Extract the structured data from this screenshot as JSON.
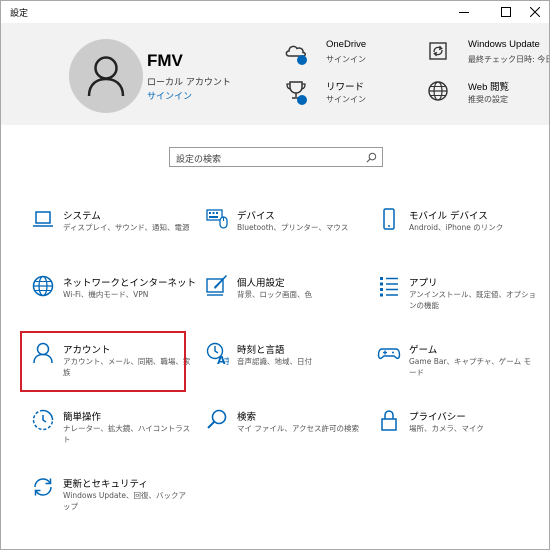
{
  "window": {
    "title": "設定"
  },
  "user": {
    "name": "FMV",
    "type": "ローカル アカウント",
    "signin": "サインイン"
  },
  "header_items": {
    "onedrive": {
      "title": "OneDrive",
      "sub": "サインイン"
    },
    "rewards": {
      "title": "リワード",
      "sub": "サインイン"
    },
    "update": {
      "title": "Windows Update",
      "sub": "最終チェック日時: 今日"
    },
    "web": {
      "title": "Web 閲覧",
      "sub": "推奨の設定"
    }
  },
  "search": {
    "placeholder": "設定の検索"
  },
  "categories": [
    {
      "title": "システム",
      "desc": "ディスプレイ、サウンド、通知、電源"
    },
    {
      "title": "デバイス",
      "desc": "Bluetooth、プリンター、マウス"
    },
    {
      "title": "モバイル デバイス",
      "desc": "Android、iPhone のリンク"
    },
    {
      "title": "ネットワークとインターネット",
      "desc": "Wi-Fi、機内モード、VPN"
    },
    {
      "title": "個人用設定",
      "desc": "背景、ロック画面、色"
    },
    {
      "title": "アプリ",
      "desc": "アンインストール、既定値、オプションの機能"
    },
    {
      "title": "アカウント",
      "desc": "アカウント、メール、同期、職場、家族"
    },
    {
      "title": "時刻と言語",
      "desc": "音声認識、地域、日付"
    },
    {
      "title": "ゲーム",
      "desc": "Game Bar、キャプチャ、ゲーム モード"
    },
    {
      "title": "簡単操作",
      "desc": "ナレーター、拡大鏡、ハイコントラスト"
    },
    {
      "title": "検索",
      "desc": "マイ ファイル、アクセス許可の検索"
    },
    {
      "title": "プライバシー",
      "desc": "場所、カメラ、マイク"
    },
    {
      "title": "更新とセキュリティ",
      "desc": "Windows Update、回復、バックアップ"
    }
  ],
  "colors": {
    "accent": "#0067b8",
    "highlight": "#d11f2c",
    "header_bg": "#f2f2f2"
  }
}
